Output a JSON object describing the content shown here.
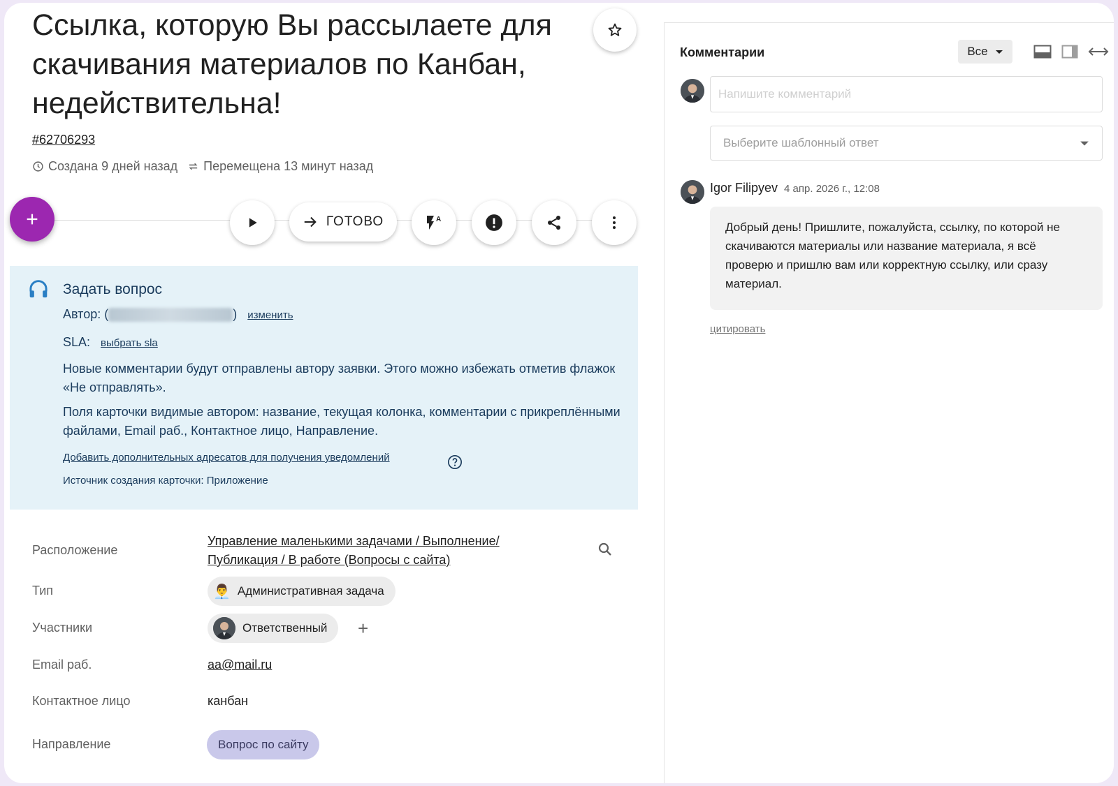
{
  "card": {
    "title": "Ссылка, которую Вы рассылаете для скачивания материалов по Канбан, недействительна!",
    "id": "#62706293",
    "created": "Создана 9 дней назад",
    "moved": "Перемещена 13 минут назад"
  },
  "actions": {
    "done_label": "ГОТОВО"
  },
  "service_desk": {
    "title": "Задать вопрос",
    "author_label": "Автор: (",
    "author_close": ")",
    "change_link": "изменить",
    "sla_label": "SLA:",
    "sla_link": "выбрать sla",
    "note1": "Новые комментарии будут отправлены автору заявки. Этого можно избежать отметив флажок «Не отправлять».",
    "note2": "Поля карточки видимые автором: название, текущая колонка, комментарии с прикреплёнными файлами, Email раб., Контактное лицо, Направление.",
    "add_recipients_link": "Добавить дополнительных адресатов для получения уведомлений",
    "source": "Источник создания карточки: Приложение"
  },
  "fields": {
    "location": {
      "label": "Расположение",
      "value": "Управление маленькими задачами / Выполнение/ Публикация / В работе (Вопросы с сайта)"
    },
    "type": {
      "label": "Тип",
      "value": "Административная задача",
      "emoji": "👨‍💼"
    },
    "members": {
      "label": "Участники",
      "value": "Ответственный"
    },
    "email": {
      "label": "Email раб.",
      "value": "aa@mail.ru"
    },
    "contact": {
      "label": "Контактное лицо",
      "value": "канбан"
    },
    "direction": {
      "label": "Направление",
      "value": "Вопрос по сайту"
    }
  },
  "comments": {
    "title": "Комментарии",
    "filter": "Все",
    "input_placeholder": "Напишите комментарий",
    "template_placeholder": "Выберите шаблонный ответ",
    "items": [
      {
        "author": "Igor Filipyev",
        "time": "4 апр. 2026 г., 12:08",
        "text": "Добрый день! Пришлите, пожалуйста, ссылку, по которой не скачиваются материалы или название материала, я всё проверю и пришлю вам или корректную ссылку, или сразу материал.",
        "quote_label": "цитировать"
      }
    ]
  },
  "colors": {
    "accent": "#9c27b0",
    "info_bg": "#e5f2f8",
    "info_text": "#1a3b5c",
    "direction_chip": "#c9c8ea"
  }
}
